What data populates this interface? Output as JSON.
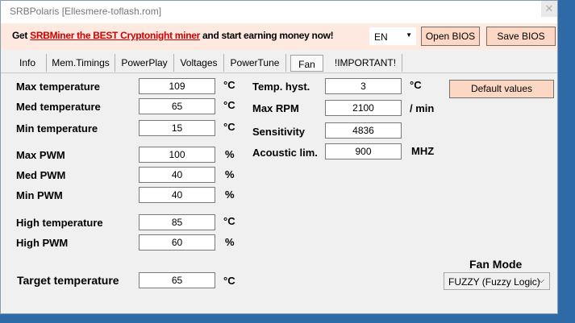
{
  "window": {
    "title": "SRBPolaris [Ellesmere-toflash.rom]",
    "close_glyph": "✕"
  },
  "banner": {
    "prefix": "Get ",
    "link": "SRBMiner the BEST Cryptonight miner",
    "suffix": " and start earning money now!"
  },
  "language": {
    "value": "EN",
    "arrow": "▼"
  },
  "buttons": {
    "open_bios": "Open BIOS",
    "save_bios": "Save BIOS",
    "default_values": "Default values"
  },
  "tabs": [
    "Info",
    "Mem.Timings",
    "PowerPlay",
    "Voltages",
    "PowerTune",
    "Fan",
    "!IMPORTANT!"
  ],
  "active_tab": "Fan",
  "fields": {
    "max_temperature": {
      "label": "Max temperature",
      "value": "109",
      "unit": "°C"
    },
    "med_temperature": {
      "label": "Med temperature",
      "value": "65",
      "unit": "°C"
    },
    "min_temperature": {
      "label": "Min temperature",
      "value": "15",
      "unit": "°C"
    },
    "max_pwm": {
      "label": "Max PWM",
      "value": "100",
      "unit": "%"
    },
    "med_pwm": {
      "label": "Med PWM",
      "value": "40",
      "unit": "%"
    },
    "min_pwm": {
      "label": "Min PWM",
      "value": "40",
      "unit": "%"
    },
    "high_temperature": {
      "label": "High temperature",
      "value": "85",
      "unit": "°C"
    },
    "high_pwm": {
      "label": "High PWM",
      "value": "60",
      "unit": "%"
    },
    "target_temperature": {
      "label": "Target temperature",
      "value": "65",
      "unit": "°C"
    },
    "temp_hyst": {
      "label": "Temp. hyst.",
      "value": "3",
      "unit": "°C"
    },
    "max_rpm": {
      "label": "Max RPM",
      "value": "2100",
      "unit": "/ min"
    },
    "sensitivity": {
      "label": "Sensitivity",
      "value": "4836"
    },
    "acoustic_lim": {
      "label": "Acoustic lim.",
      "value": "900",
      "unit": "MHZ"
    }
  },
  "fan_mode": {
    "label": "Fan Mode",
    "value": "FUZZY (Fuzzy Logic)",
    "arrow": "⌵"
  },
  "colors": {
    "banner_bg": "#fde9e0",
    "button_bg": "#fcd8c4",
    "link": "#d00000",
    "desktop": "#2d6aa6"
  }
}
